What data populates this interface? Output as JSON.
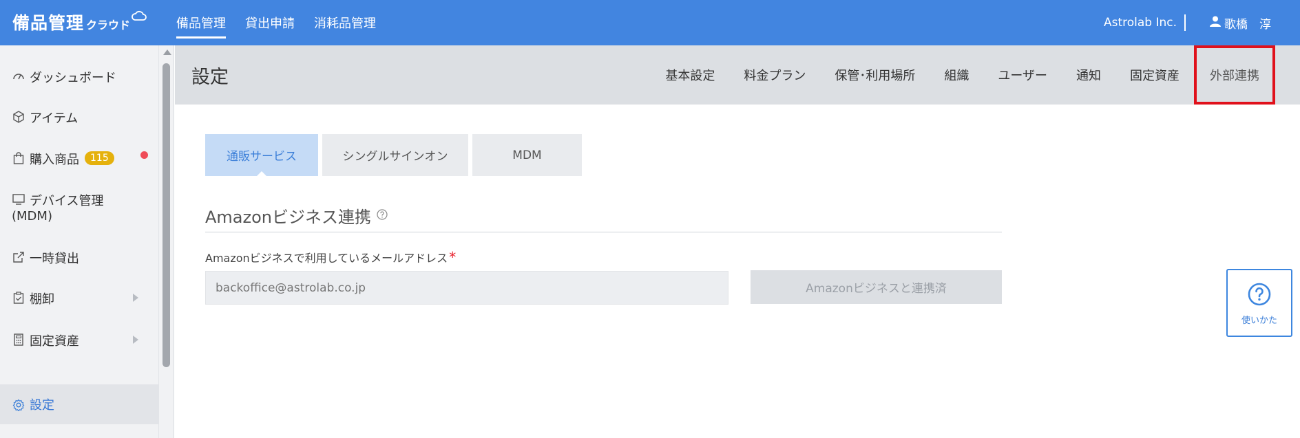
{
  "app": {
    "logo_text": "備品管理",
    "logo_sub": "クラウド"
  },
  "topnav": {
    "items": [
      {
        "label": "備品管理",
        "active": true
      },
      {
        "label": "貸出申請",
        "active": false
      },
      {
        "label": "消耗品管理",
        "active": false
      }
    ]
  },
  "header_right": {
    "company": "Astrolab Inc.",
    "user_name": "歌橋　淳"
  },
  "sidebar": {
    "items": [
      {
        "label": "ダッシュボード",
        "icon": "dashboard-icon"
      },
      {
        "label": "アイテム",
        "icon": "cube-icon"
      },
      {
        "label": "購入商品",
        "icon": "shopping-bag-icon",
        "badge": "115"
      },
      {
        "label": "デバイス管理",
        "label2": "(MDM)",
        "icon": "monitor-icon"
      },
      {
        "label": "一時貸出",
        "icon": "external-link-icon"
      },
      {
        "label": "棚卸",
        "icon": "clipboard-check-icon"
      },
      {
        "label": "固定資産",
        "icon": "calculator-icon"
      },
      {
        "label": "設定",
        "icon": "gear-icon",
        "active": true
      }
    ]
  },
  "content": {
    "title": "設定",
    "tabs": [
      {
        "label": "基本設定"
      },
      {
        "label": "料金プラン"
      },
      {
        "label": "保管･利用場所"
      },
      {
        "label": "組織"
      },
      {
        "label": "ユーザー"
      },
      {
        "label": "通知"
      },
      {
        "label": "固定資産"
      },
      {
        "label": "外部連携",
        "active": true
      }
    ],
    "subtabs": [
      {
        "label": "通販サービス",
        "active": true
      },
      {
        "label": "シングルサインオン"
      },
      {
        "label": "MDM"
      }
    ],
    "section_title": "Amazonビジネス連携",
    "field_label": "Amazonビジネスで利用しているメールアドレス",
    "required_mark": "*",
    "email_value": "backoffice@astrolab.co.jp",
    "linked_button": "Amazonビジネスと連携済"
  },
  "help_widget": {
    "label": "使いかた"
  },
  "colors": {
    "header_blue": "#4285e0",
    "accent_blue": "#3a7ed8",
    "highlight_red": "#e0111b",
    "badge_yellow": "#e5b10c",
    "dot_red": "#ef4c58"
  }
}
